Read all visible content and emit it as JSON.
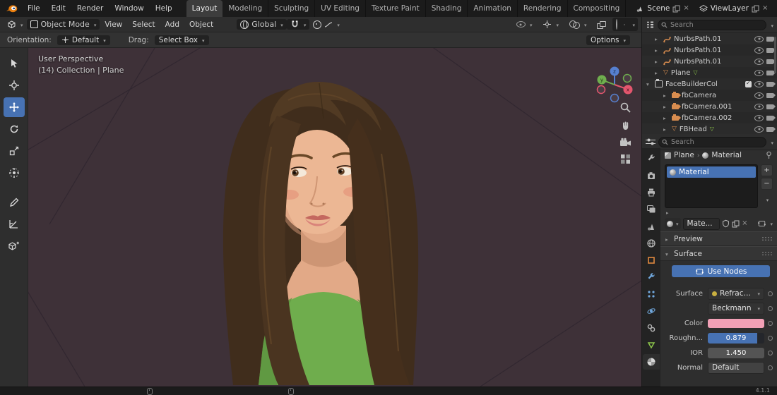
{
  "topbar": {
    "menus": [
      "File",
      "Edit",
      "Render",
      "Window",
      "Help"
    ],
    "workspaces": [
      "Layout",
      "Modeling",
      "Sculpting",
      "UV Editing",
      "Texture Paint",
      "Shading",
      "Animation",
      "Rendering",
      "Compositing"
    ],
    "active_workspace": "Layout",
    "scene_label": "Scene",
    "viewlayer_label": "ViewLayer"
  },
  "viewport_header": {
    "mode": "Object Mode",
    "menus": [
      "View",
      "Select",
      "Add",
      "Object"
    ],
    "orientation": "Global"
  },
  "tool_settings": {
    "orientation_label": "Orientation:",
    "orientation_value": "Default",
    "drag_label": "Drag:",
    "drag_value": "Select Box",
    "options_label": "Options"
  },
  "viewport": {
    "perspective_text": "User Perspective",
    "collection_text": "(14) Collection | Plane",
    "axis_labels": {
      "x": "x",
      "y": "y",
      "z": "z"
    },
    "background_color": "#3e3138"
  },
  "outliner": {
    "search_placeholder": "Search",
    "items": [
      {
        "label": "NurbsPath.01",
        "type": "curve"
      },
      {
        "label": "NurbsPath.01",
        "type": "curve"
      },
      {
        "label": "NurbsPath.01",
        "type": "curve"
      },
      {
        "label": "Plane",
        "type": "mesh"
      },
      {
        "label": "FaceBuilderCol",
        "type": "collection"
      },
      {
        "label": "fbCamera",
        "type": "camera"
      },
      {
        "label": "fbCamera.001",
        "type": "camera"
      },
      {
        "label": "fbCamera.002",
        "type": "camera"
      },
      {
        "label": "FBHead",
        "type": "mesh"
      }
    ]
  },
  "properties": {
    "search_placeholder": "Search",
    "breadcrumb": {
      "object": "Plane",
      "data": "Material"
    },
    "slot_name": "Material",
    "slot_buttons": {
      "add": "+",
      "remove": "−"
    },
    "material_name": "Mate...",
    "preview_label": "Preview",
    "surface_label": "Surface",
    "use_nodes_label": "Use Nodes",
    "rows": {
      "surface": {
        "label": "Surface",
        "value": "Refractio..."
      },
      "distribution": {
        "value": "Beckmann"
      },
      "color": {
        "label": "Color",
        "swatch": "#f2a0b6"
      },
      "roughness": {
        "label": "Roughn...",
        "value": "0.879"
      },
      "ior": {
        "label": "IOR",
        "value": "1.450"
      },
      "normal": {
        "label": "Normal",
        "value": "Default"
      }
    },
    "tabs": [
      "tool",
      "render",
      "output",
      "view-layer",
      "scene",
      "world",
      "object",
      "modifiers",
      "particles",
      "physics",
      "constraints",
      "object-data",
      "material"
    ]
  },
  "statusbar": {
    "version": "4.1.1"
  },
  "colors": {
    "accent": "#4772b3",
    "viewport_bg": "#3e3138"
  }
}
